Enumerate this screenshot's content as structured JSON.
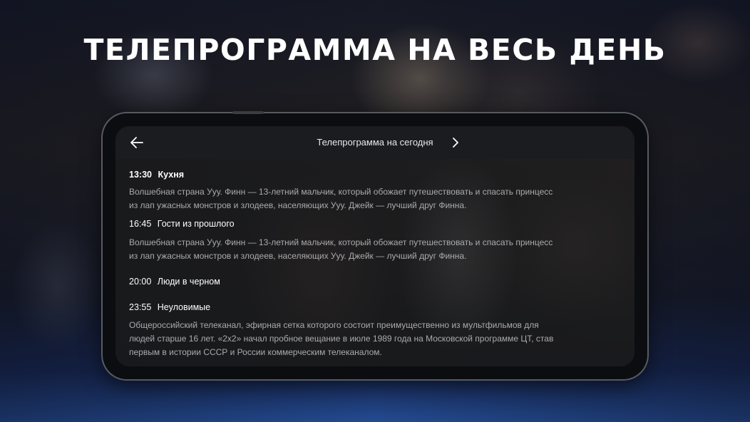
{
  "headline": "ТЕЛЕПРОГРАММА НА ВЕСЬ ДЕНЬ",
  "header": {
    "title": "Телепрограмма на сегодня",
    "back_icon": "arrow-left-icon",
    "next_icon": "chevron-right-icon"
  },
  "programs": [
    {
      "time": "13:30",
      "name": "Кухня",
      "desc_lines": [
        "Волшебная страна Ууу. Финн — 13-летний мальчик, который обожает путешествовать и спасать принцесс",
        "из лап ужасных монстров и злодеев, населяющих Ууу. Джейк — лучший друг Финна."
      ]
    },
    {
      "time": "16:45",
      "name": "Гости из прошлого",
      "desc_lines": [
        "Волшебная страна Ууу. Финн — 13-летний мальчик, который обожает путешествовать и спасать принцесс",
        "из лап ужасных монстров и злодеев, населяющих Ууу. Джейк — лучший друг Финна."
      ]
    },
    {
      "time": "20:00",
      "name": "Люди в черном",
      "desc_lines": []
    },
    {
      "time": "23:55",
      "name": "Неуловимые",
      "desc_lines": [
        "Общероссийский телеканал, эфирная сетка которого состоит преимущественно из мультфильмов для",
        "людей старше 16 лет. «2x2» начал пробное вещание в июле 1989 года на Московской программе ЦТ, став",
        "первым в истории СССР и России коммерческим телеканалом."
      ]
    }
  ],
  "colors": {
    "accent_blue": "#2c5fb8",
    "text_primary": "#ffffff",
    "text_secondary": "#a9abae",
    "topbar": "#1b1c1f"
  }
}
